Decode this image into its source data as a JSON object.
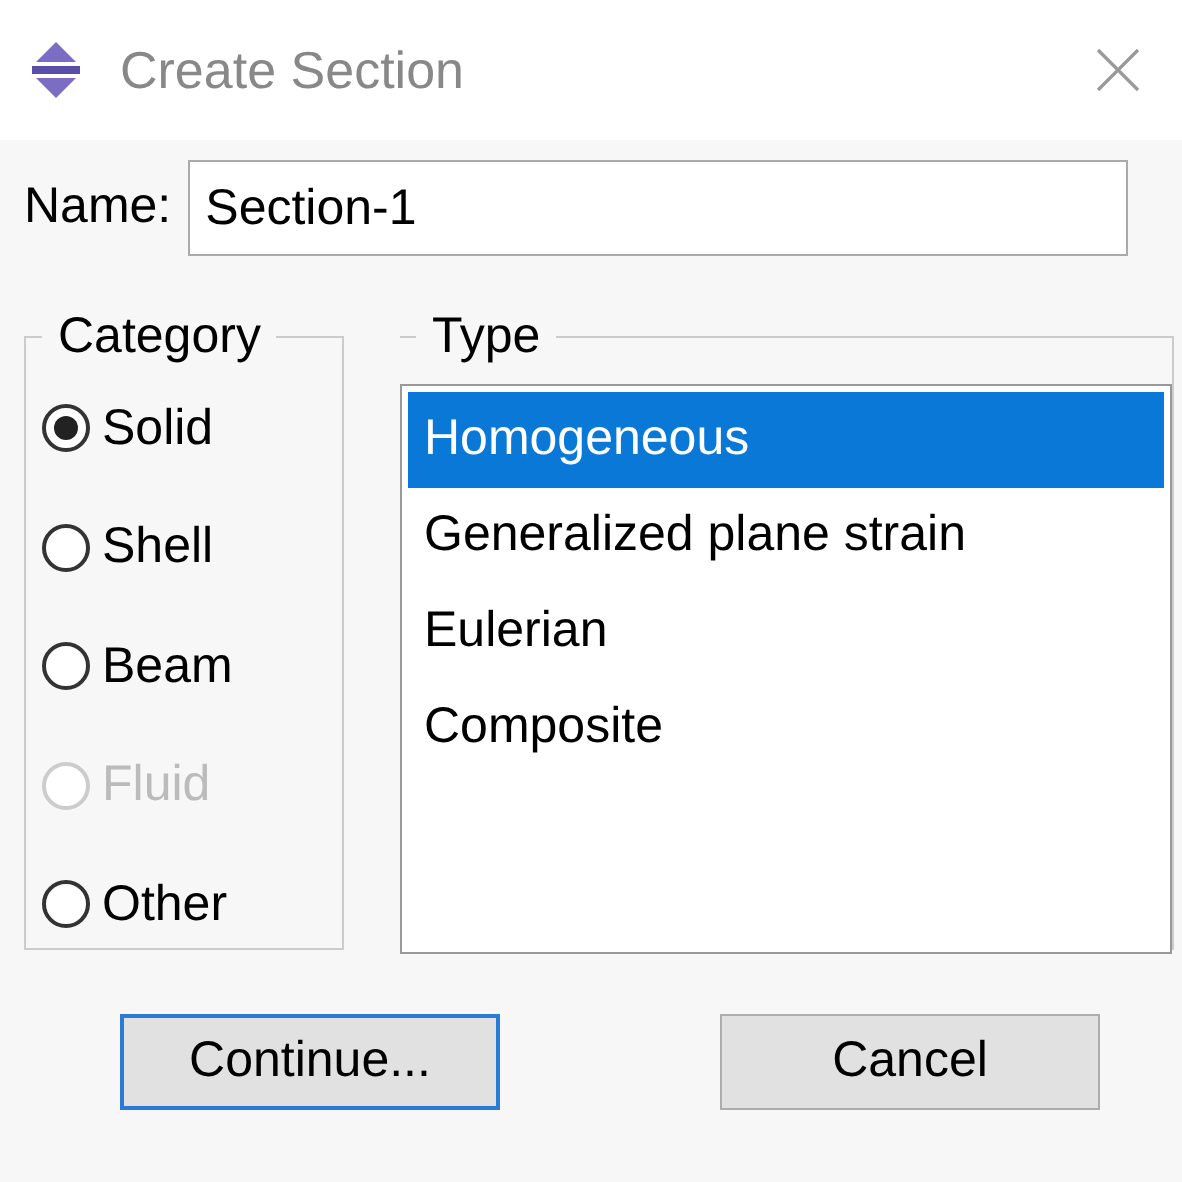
{
  "window": {
    "title": "Create Section"
  },
  "name_field": {
    "label": "Name:",
    "value": "Section-1"
  },
  "category": {
    "title": "Category",
    "options": [
      {
        "label": "Solid",
        "selected": true,
        "disabled": false
      },
      {
        "label": "Shell",
        "selected": false,
        "disabled": false
      },
      {
        "label": "Beam",
        "selected": false,
        "disabled": false
      },
      {
        "label": "Fluid",
        "selected": false,
        "disabled": true
      },
      {
        "label": "Other",
        "selected": false,
        "disabled": false
      }
    ]
  },
  "type": {
    "title": "Type",
    "items": [
      {
        "label": "Homogeneous",
        "selected": true
      },
      {
        "label": "Generalized plane strain",
        "selected": false
      },
      {
        "label": "Eulerian",
        "selected": false
      },
      {
        "label": "Composite",
        "selected": false
      }
    ]
  },
  "buttons": [
    {
      "label": "Continue...",
      "default": true
    },
    {
      "label": "Cancel",
      "default": false
    }
  ]
}
